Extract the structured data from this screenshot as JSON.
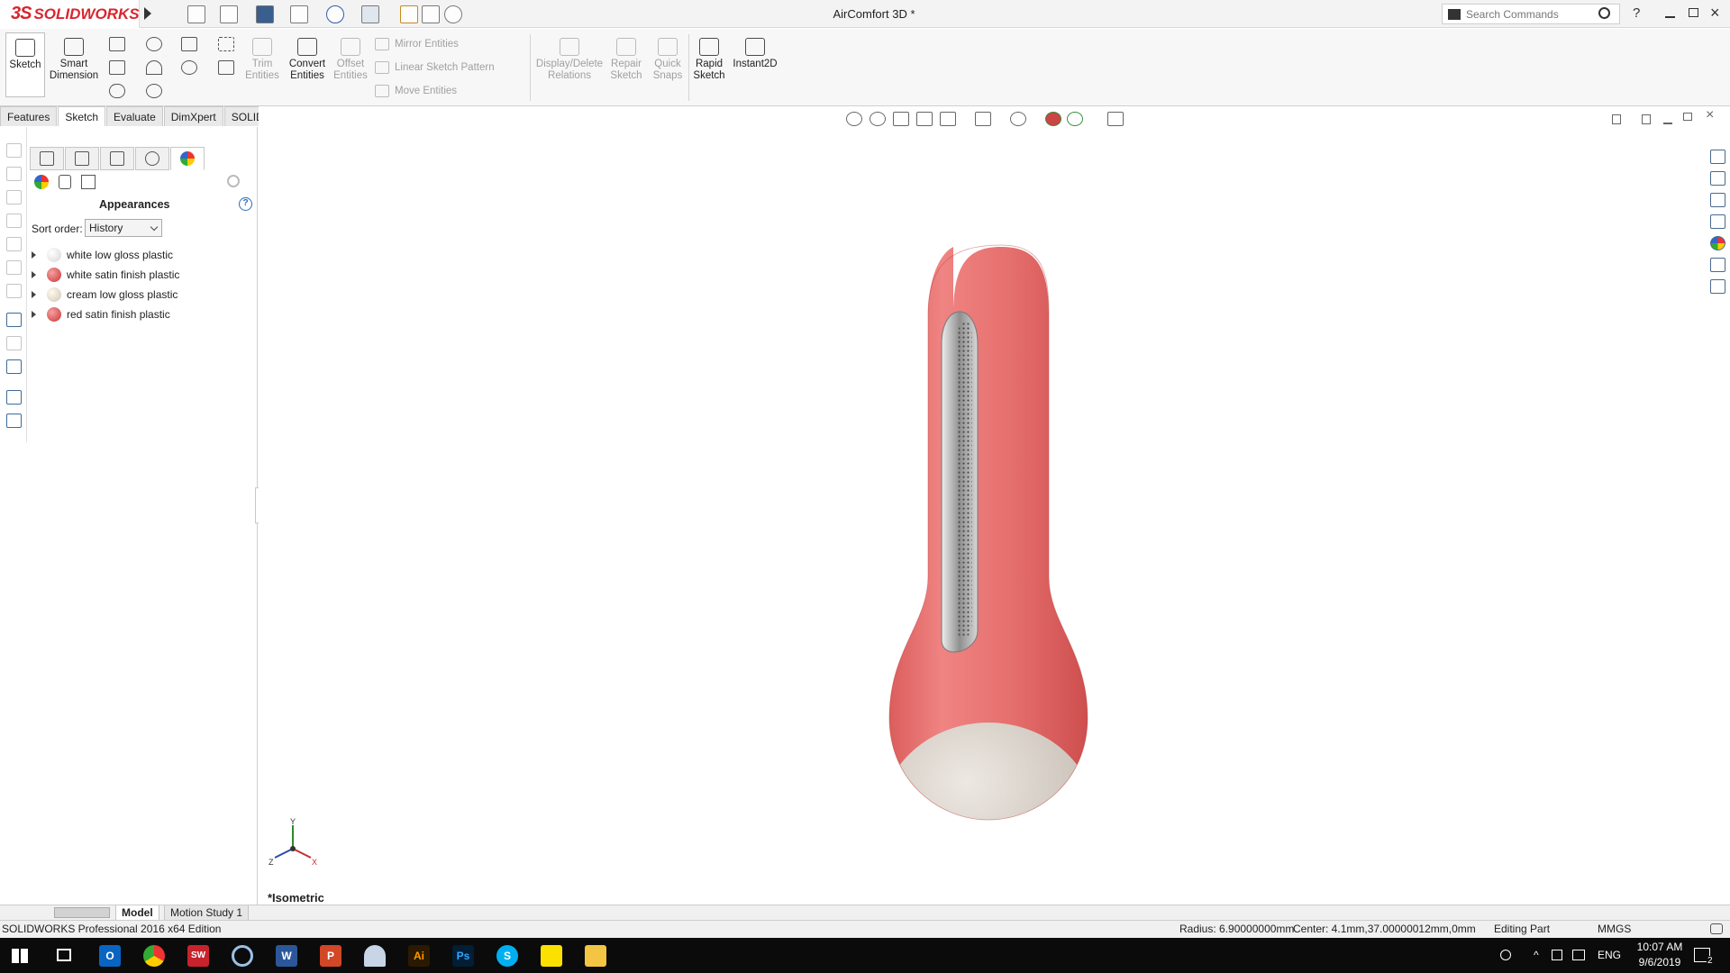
{
  "app": {
    "brand_ds": "3S",
    "brand_name": "SOLIDWORKS",
    "doc_title": "AirComfort 3D *"
  },
  "search": {
    "placeholder": "Search Commands"
  },
  "commands": {
    "sketch": "Sketch",
    "smart_dimension": [
      "Smart",
      "Dimension"
    ],
    "trim_entities": [
      "Trim",
      "Entities"
    ],
    "convert_entities": [
      "Convert",
      "Entities"
    ],
    "offset_entities": [
      "Offset",
      "Entities"
    ],
    "mirror_entities": "Mirror Entities",
    "linear_sketch_pattern": "Linear Sketch Pattern",
    "move_entities": "Move Entities",
    "display_delete_relations": [
      "Display/Delete",
      "Relations"
    ],
    "repair_sketch": [
      "Repair",
      "Sketch"
    ],
    "quick_snaps": [
      "Quick",
      "Snaps"
    ],
    "rapid_sketch": [
      "Rapid",
      "Sketch"
    ],
    "instant2d": "Instant2D"
  },
  "tabs": [
    "Features",
    "Sketch",
    "Evaluate",
    "DimXpert",
    "SOLIDWORKS Add-Ins"
  ],
  "active_tab": "Sketch",
  "panel": {
    "title": "Appearances",
    "help": "?",
    "sort_label": "Sort order:",
    "sort_value": "History",
    "items": [
      {
        "label": "white low gloss plastic",
        "color": "#f0f0f0"
      },
      {
        "label": "white satin finish plastic",
        "color": "#d94848"
      },
      {
        "label": "cream low gloss plastic",
        "color": "#ece6d6"
      },
      {
        "label": "red satin finish plastic",
        "color": "#d94848"
      }
    ]
  },
  "viewport": {
    "view_label": "*Isometric",
    "triad": {
      "y": "Y",
      "x": "X",
      "z": "Z"
    }
  },
  "bottom_tabs": [
    "Model",
    "Motion Study 1"
  ],
  "status": {
    "edition": "SOLIDWORKS Professional 2016 x64 Edition",
    "radius": "Radius: 6.90000000mm",
    "center": "Center: 4.1mm,37.00000012mm,0mm",
    "mode": "Editing Part",
    "units": "MMGS"
  },
  "taskbar": {
    "lang": "ENG",
    "time": "10:07 AM",
    "date": "9/6/2019",
    "notifications": "2",
    "apps": [
      "Outlook",
      "Chrome",
      "SOLIDWORKS 2016",
      "Word",
      "PowerPoint",
      "Illustrator",
      "Photoshop",
      "Skype",
      "Sticky Notes",
      "File Explorer"
    ]
  },
  "colors": {
    "accent": "#d8262f",
    "model_red": "#e06866",
    "model_base": "#d9d2c9",
    "grille": "#9a9a9a"
  }
}
